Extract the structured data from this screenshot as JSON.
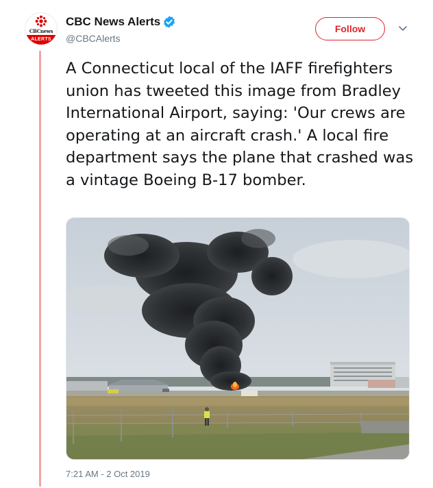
{
  "account": {
    "avatar_brand": "CBCnews",
    "avatar_badge": "ALERTS",
    "display_name": "CBC News Alerts",
    "handle": "@CBCAlerts",
    "verified": true
  },
  "actions": {
    "follow_label": "Follow",
    "more_icon": "chevron-down-icon"
  },
  "tweet": {
    "text": "A Connecticut local of the IAFF firefighters union has tweeted this image from Bradley International Airport, saying: 'Our crews are operating at an aircraft crash.' A local fire department says the plane that crashed was a vintage Boeing B-17 bomber.",
    "timestamp": "7:21 AM - 2 Oct 2019"
  },
  "colors": {
    "brand_red": "#e0242b",
    "thread_line": "#f4a3a3",
    "verified_blue": "#1da1f2",
    "muted_text": "#657786"
  }
}
